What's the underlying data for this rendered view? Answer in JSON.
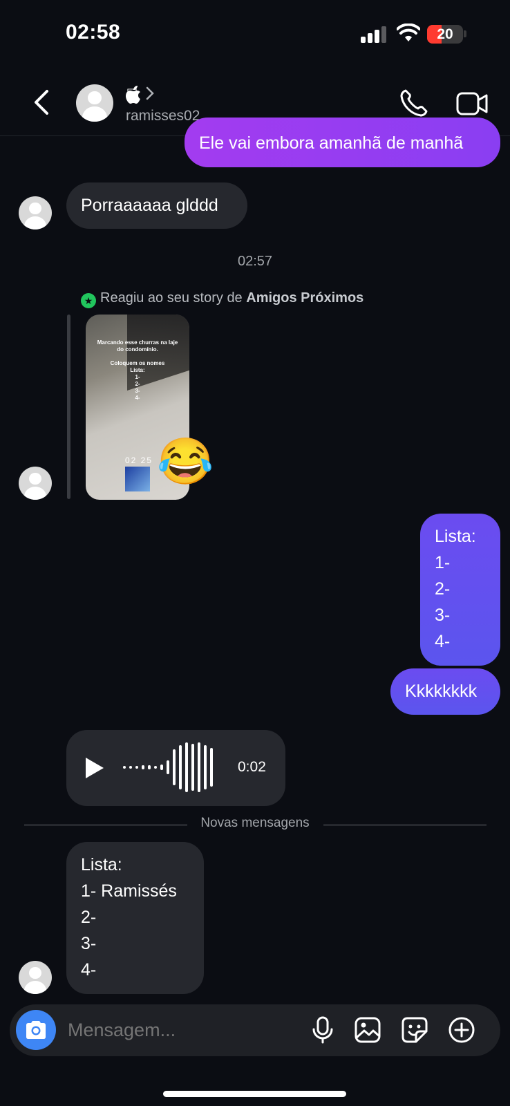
{
  "status": {
    "time": "02:58",
    "battery": "20"
  },
  "header": {
    "contact_icon": "apple-icon",
    "username": "ramisses02"
  },
  "messages": {
    "top_outgoing": "Ele vai embora amanhã de manhã",
    "incoming_1": "Porraaaaaa glddd",
    "timestamp": "02:57",
    "reaction_prefix": "Reagiu ao seu story de ",
    "reaction_audience": "Amigos Próximos",
    "story_text": "Marcando esse churras na laje\ndo condomínio.\n\nColoquem os nomes\nLista:\n1-\n2-\n3-\n4-",
    "story_clock": "02 25",
    "reaction_emoji": "😂",
    "outgoing_list": "Lista:\n1-\n2-\n3-\n4-",
    "outgoing_kkk": "Kkkkkkkk",
    "audio_duration": "0:02",
    "new_messages_label": "Novas mensagens",
    "incoming_list": "Lista:\n1- Ramissés\n2-\n3-\n4-"
  },
  "composer": {
    "placeholder": "Mensagem..."
  },
  "colors": {
    "background": "#0b0d13",
    "outgoing_purple": "#a33cf0",
    "outgoing_blue": "#5b55ee",
    "incoming": "#26282e",
    "camera_button": "#3e86f5"
  }
}
